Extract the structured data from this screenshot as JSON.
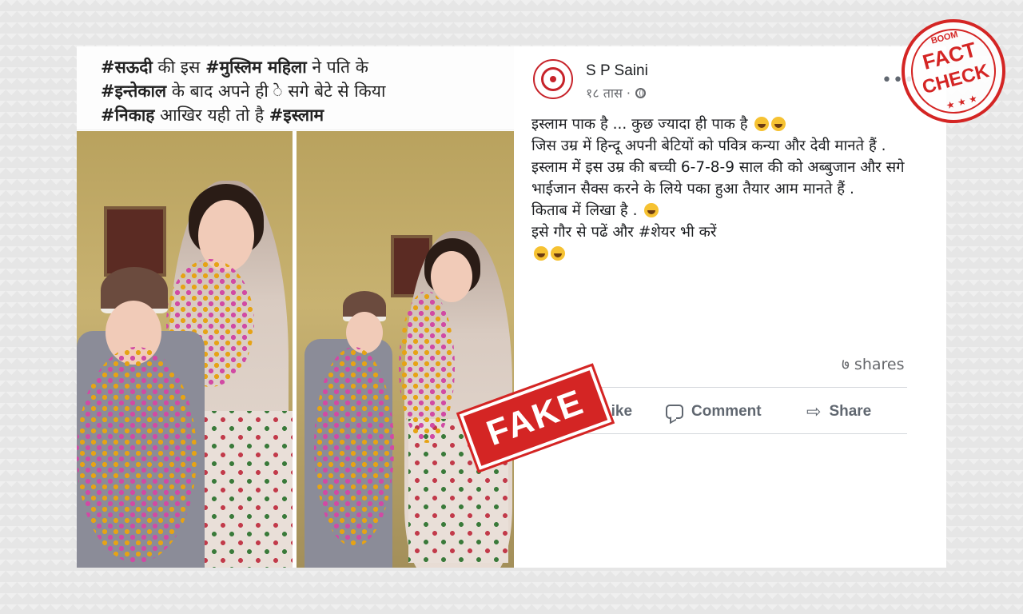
{
  "caption": {
    "line1": [
      {
        "text": "#सऊदी",
        "bold": true
      },
      {
        "text": " की इस ",
        "bold": false
      },
      {
        "text": "#मुस्लिम  महिला",
        "bold": true
      },
      {
        "text": " ने पति के",
        "bold": false
      }
    ],
    "line2": [
      {
        "text": "#इन्तेकाल",
        "bold": true
      },
      {
        "text": " के बाद अपने ही े सगे बेटे से किया",
        "bold": false
      }
    ],
    "line3": [
      {
        "text": "#निकाह",
        "bold": true
      },
      {
        "text": " आखिर यही तो है ",
        "bold": false
      },
      {
        "text": "#इस्लाम",
        "bold": true
      }
    ]
  },
  "post": {
    "author": "S P Saini",
    "time": "१८ तास ·",
    "more_label": "•••",
    "body": [
      "इस्लाम पाक है ... कुछ ज्यादा ही पाक है",
      "जिस उम्र में हिन्दू अपनी बेटियों को पवित्र कन्या और देवी मानते हैं .",
      "इस्लाम में इस उम्र की बच्ची 6-7-8-9 साल की को अब्बुजान और सगे भाईजान सैक्स करने के लिये पका हुआ तैयार आम मानते हैं .",
      "किताब में लिखा है .",
      "इसे गौर से पढें और #शेयर भी करें"
    ],
    "share_bold": "#शेयर",
    "shares": "७ shares",
    "actions": {
      "like": "Like",
      "comment": "Comment",
      "share": "Share"
    }
  },
  "stamps": {
    "fake": "FAKE",
    "fact_check_top": "BOOM",
    "fact_check_1": "FACT",
    "fact_check_2": "CHECK",
    "fact_check_stars": "★ ★ ★"
  },
  "colors": {
    "stamp_red": "#d42524",
    "text": "#1c1e21",
    "muted": "#65676b"
  }
}
